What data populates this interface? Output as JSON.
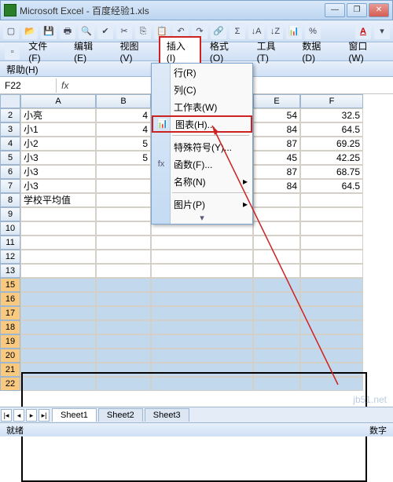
{
  "window": {
    "app": "Microsoft Excel",
    "doc": "百度经验1.xls",
    "min": "—",
    "max": "❐",
    "close": "✕"
  },
  "menus": {
    "file": "文件(F)",
    "edit": "编辑(E)",
    "view": "视图(V)",
    "insert": "插入(I)",
    "format": "格式(O)",
    "tools": "工具(T)",
    "data": "数据(D)",
    "window": "窗口(W)",
    "help": "帮助(H)"
  },
  "namebox": {
    "ref": "F22",
    "fx": "fx"
  },
  "columns": {
    "A": "A",
    "B": "B",
    "E": "E",
    "F": "F"
  },
  "rows": [
    {
      "n": "2",
      "a": "小亮",
      "b": "4",
      "e": "54",
      "f": "32.5"
    },
    {
      "n": "3",
      "a": "小1",
      "b": "4",
      "e": "84",
      "f": "64.5"
    },
    {
      "n": "4",
      "a": "小2",
      "b": "5",
      "e": "87",
      "f": "69.25"
    },
    {
      "n": "5",
      "a": "小3",
      "b": "5",
      "e": "45",
      "f": "42.25"
    },
    {
      "n": "6",
      "a": "小3",
      "b": "",
      "e": "87",
      "f": "68.75"
    },
    {
      "n": "7",
      "a": "小3",
      "b": "",
      "e": "84",
      "f": "64.5"
    },
    {
      "n": "8",
      "a": "学校平均值",
      "b": "",
      "e": "",
      "f": ""
    }
  ],
  "empty_rows": [
    "9",
    "10",
    "11",
    "12",
    "13"
  ],
  "sel_rows": [
    "15",
    "16",
    "17",
    "18",
    "19",
    "20",
    "21",
    "22"
  ],
  "dropdown": {
    "row": "行(R)",
    "col": "列(C)",
    "sheet": "工作表(W)",
    "chart": "图表(H)...",
    "special": "特殊符号(Y)...",
    "func": "函数(F)...",
    "name": "名称(N)",
    "pic": "图片(P)"
  },
  "icons": {
    "chart": "📊",
    "func": "fx"
  },
  "tabs": {
    "s1": "Sheet1",
    "s2": "Sheet2",
    "s3": "Sheet3"
  },
  "status": {
    "left": "就绪",
    "right": "数字"
  },
  "watermark": "jb51.net",
  "toolbar_font": "A"
}
